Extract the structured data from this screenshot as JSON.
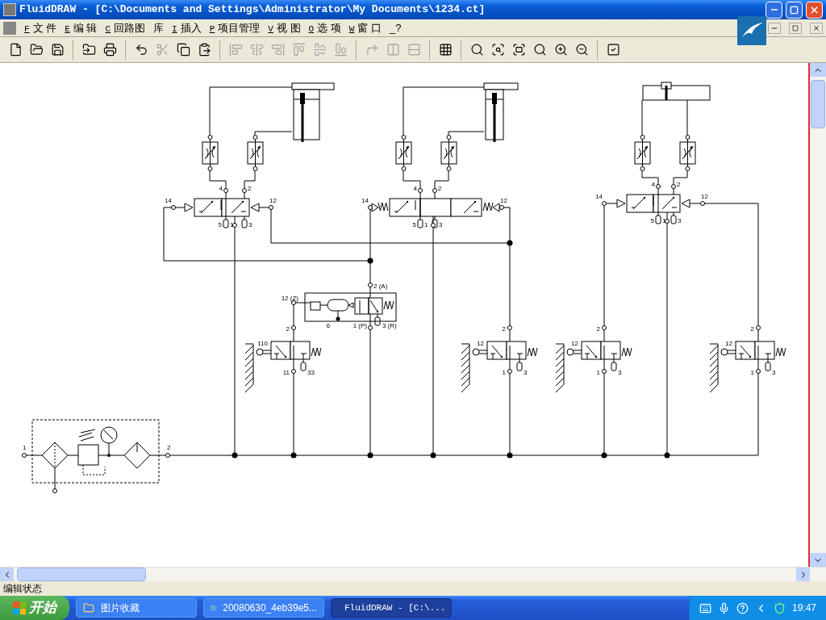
{
  "window": {
    "title": "FluidDRAW - [C:\\Documents and Settings\\Administrator\\My Documents\\1234.ct]"
  },
  "menu": [
    {
      "key": "F",
      "label": "文 件"
    },
    {
      "key": "E",
      "label": "编 辑"
    },
    {
      "key": "C",
      "label": "回路图"
    },
    {
      "label": "库"
    },
    {
      "key": "I",
      "label": "插入"
    },
    {
      "key": "P",
      "label": "项目管理"
    },
    {
      "key": "V",
      "label": "视 图"
    },
    {
      "key": "O",
      "label": "选 项"
    },
    {
      "key": "W",
      "label": "窗 口"
    },
    {
      "label": "_?"
    }
  ],
  "toolbar": [
    [
      {
        "kind": "new",
        "disabled": false
      },
      {
        "kind": "open",
        "disabled": false
      },
      {
        "kind": "save",
        "disabled": false
      }
    ],
    [
      {
        "kind": "export",
        "disabled": false
      },
      {
        "kind": "print",
        "disabled": false
      }
    ],
    [
      {
        "kind": "undo",
        "disabled": false
      },
      {
        "kind": "cut",
        "disabled": true
      },
      {
        "kind": "copy",
        "disabled": false
      },
      {
        "kind": "paste",
        "disabled": false
      }
    ],
    [
      {
        "kind": "align-left",
        "disabled": true
      },
      {
        "kind": "align-center",
        "disabled": true
      },
      {
        "kind": "align-right",
        "disabled": true
      },
      {
        "kind": "align-top",
        "disabled": true
      },
      {
        "kind": "align-middle",
        "disabled": true
      },
      {
        "kind": "align-bottom",
        "disabled": true
      }
    ],
    [
      {
        "kind": "rotate",
        "disabled": true
      },
      {
        "kind": "flip-h",
        "disabled": true
      },
      {
        "kind": "flip-v",
        "disabled": true
      }
    ],
    [
      {
        "kind": "grid",
        "disabled": false
      }
    ],
    [
      {
        "kind": "zoom-actual",
        "disabled": false
      },
      {
        "kind": "zoom-width",
        "disabled": false
      },
      {
        "kind": "zoom-all",
        "disabled": false
      },
      {
        "kind": "zoom-window",
        "disabled": false
      },
      {
        "kind": "zoom-in",
        "disabled": false
      },
      {
        "kind": "zoom-out",
        "disabled": false
      }
    ],
    [
      {
        "kind": "check",
        "disabled": false
      }
    ]
  ],
  "diagram": {
    "valves": [
      {
        "kind": "two_position",
        "labels": [
          "14",
          "12",
          "4",
          "2",
          "5",
          "1",
          "3"
        ]
      },
      {
        "kind": "three_position",
        "labels": [
          "14",
          "12",
          "4",
          "2",
          "5",
          "1",
          "3"
        ]
      },
      {
        "kind": "two_position",
        "labels": [
          "14",
          "12",
          "4",
          "2",
          "5",
          "1",
          "3"
        ]
      }
    ],
    "timer": {
      "labels": [
        "2 (A)",
        "12 (Z)",
        "6",
        "1 (P)",
        "3 (R)"
      ]
    },
    "roller_valves": [
      {
        "labels": [
          "110",
          "2",
          "11",
          "33"
        ]
      },
      {
        "labels": [
          "12",
          "2",
          "1",
          "3"
        ]
      },
      {
        "labels": [
          "12",
          "2",
          "1",
          "3"
        ]
      },
      {
        "labels": [
          "12",
          "2",
          "1",
          "3"
        ]
      }
    ],
    "service_unit": {
      "labels": [
        "1",
        "2"
      ]
    }
  },
  "status_bar": "编辑状态",
  "taskbar": {
    "start": "开始",
    "tasks": [
      {
        "label": "图片收藏",
        "selected": false
      },
      {
        "label": "20080630_4eb39e5...",
        "selected": false
      },
      {
        "label": "FluidDRAW - [C:\\...",
        "selected": true
      }
    ],
    "clock": "19:47"
  }
}
